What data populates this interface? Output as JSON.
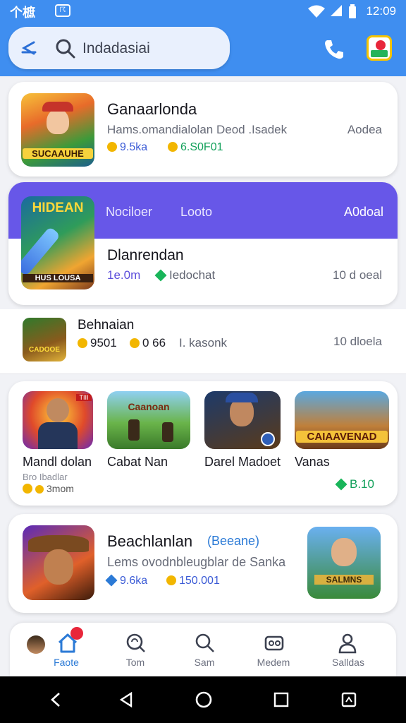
{
  "status_bar": {
    "left_glyph": "个樜",
    "left_badge": "☈",
    "time": "12:09"
  },
  "search": {
    "placeholder": "Indadasiai"
  },
  "header_icons": [
    "back-arrow-icon",
    "search-icon",
    "phone-icon",
    "store-notification-icon"
  ],
  "cards": [
    {
      "thumb_text": "SUCAAUHE",
      "title": "Ganaarlonda",
      "subtitle": "Hams.omandialolan Deod .Isadek",
      "right": "Aodea",
      "meta": [
        "9.5ka",
        "6.S0F01"
      ]
    },
    {
      "thumb_text_top": "HIDEAN",
      "thumb_text_bottom": "HUS LOUSA",
      "header_left": "Nociloer",
      "header_mid": "Looto",
      "header_right": "A0doal",
      "title": "Dlanrendan",
      "meta_left": "1e.0m",
      "meta_mid": "Iedochat",
      "right": "10 d oeal"
    },
    {
      "thumb_text": "CADOOE",
      "title": "Behnaian",
      "meta": [
        "9501",
        "0 66",
        "I. kasonk"
      ],
      "right": "10 dloela"
    }
  ],
  "carousel": [
    {
      "name": "Mandl dolan",
      "sub": "Bro Ibadlar",
      "meta": "3mom",
      "thumb_text": "TIII"
    },
    {
      "name": "Cabat Nan",
      "thumb_text": "Caanoan"
    },
    {
      "name": "Darel Madoet",
      "thumb_text": ""
    },
    {
      "name": "Vanas",
      "thumb_text": "CAIAAVENAD",
      "meta": "B.10"
    }
  ],
  "featured": {
    "title": "Beachlanlan",
    "tag": "(Beeane)",
    "subtitle": "Lems ovodnbleugblar de Sanka",
    "meta": [
      "9.6ka",
      "150.001"
    ],
    "thumb_text": "SALMNS"
  },
  "bottom_nav": [
    {
      "label": "Faote",
      "active": true
    },
    {
      "label": "Tom"
    },
    {
      "label": "Sam"
    },
    {
      "label": "Medem"
    },
    {
      "label": "Salldas"
    }
  ],
  "colors": {
    "header": "#3f8ef0",
    "accent": "#6757e8",
    "badge": "#e8263a",
    "green": "#12a05a"
  }
}
